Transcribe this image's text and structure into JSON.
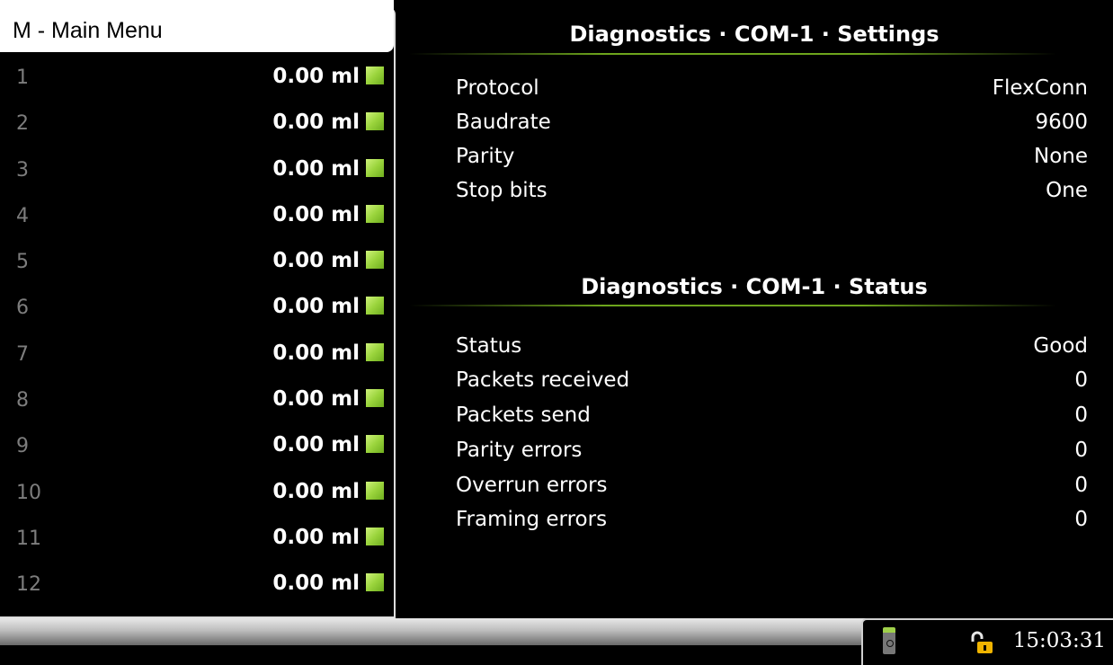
{
  "left_panel": {
    "menu_title": "M - Main Menu",
    "channels": [
      {
        "number": "1",
        "value": "0.00 ml"
      },
      {
        "number": "2",
        "value": "0.00 ml"
      },
      {
        "number": "3",
        "value": "0.00 ml"
      },
      {
        "number": "4",
        "value": "0.00 ml"
      },
      {
        "number": "5",
        "value": "0.00 ml"
      },
      {
        "number": "6",
        "value": "0.00 ml"
      },
      {
        "number": "7",
        "value": "0.00 ml"
      },
      {
        "number": "8",
        "value": "0.00 ml"
      },
      {
        "number": "9",
        "value": "0.00 ml"
      },
      {
        "number": "10",
        "value": "0.00 ml"
      },
      {
        "number": "11",
        "value": "0.00 ml"
      },
      {
        "number": "12",
        "value": "0.00 ml"
      }
    ],
    "led_color": "#9ad43c"
  },
  "settings": {
    "title": "Diagnostics · COM-1 · Settings",
    "rows": [
      {
        "label": "Protocol",
        "value": "FlexConn"
      },
      {
        "label": "Baudrate",
        "value": "9600"
      },
      {
        "label": "Parity",
        "value": "None"
      },
      {
        "label": "Stop bits",
        "value": "One"
      }
    ]
  },
  "status": {
    "title": "Diagnostics · COM-1 · Status",
    "rows": [
      {
        "label": "Status",
        "value": "Good"
      },
      {
        "label": "Packets received",
        "value": "0"
      },
      {
        "label": "Packets send",
        "value": "0"
      },
      {
        "label": "Parity errors",
        "value": "0"
      },
      {
        "label": "Overrun errors",
        "value": "0"
      },
      {
        "label": "Framing errors",
        "value": "0"
      }
    ]
  },
  "tray": {
    "device_icon": "handheld-device-icon",
    "lock_icon": "unlocked-padlock-icon",
    "time": "15:03:31"
  },
  "colors": {
    "accent_line": "#6da51c",
    "label_grey": "#7d7d7d",
    "lock_yellow": "#f0b400"
  }
}
